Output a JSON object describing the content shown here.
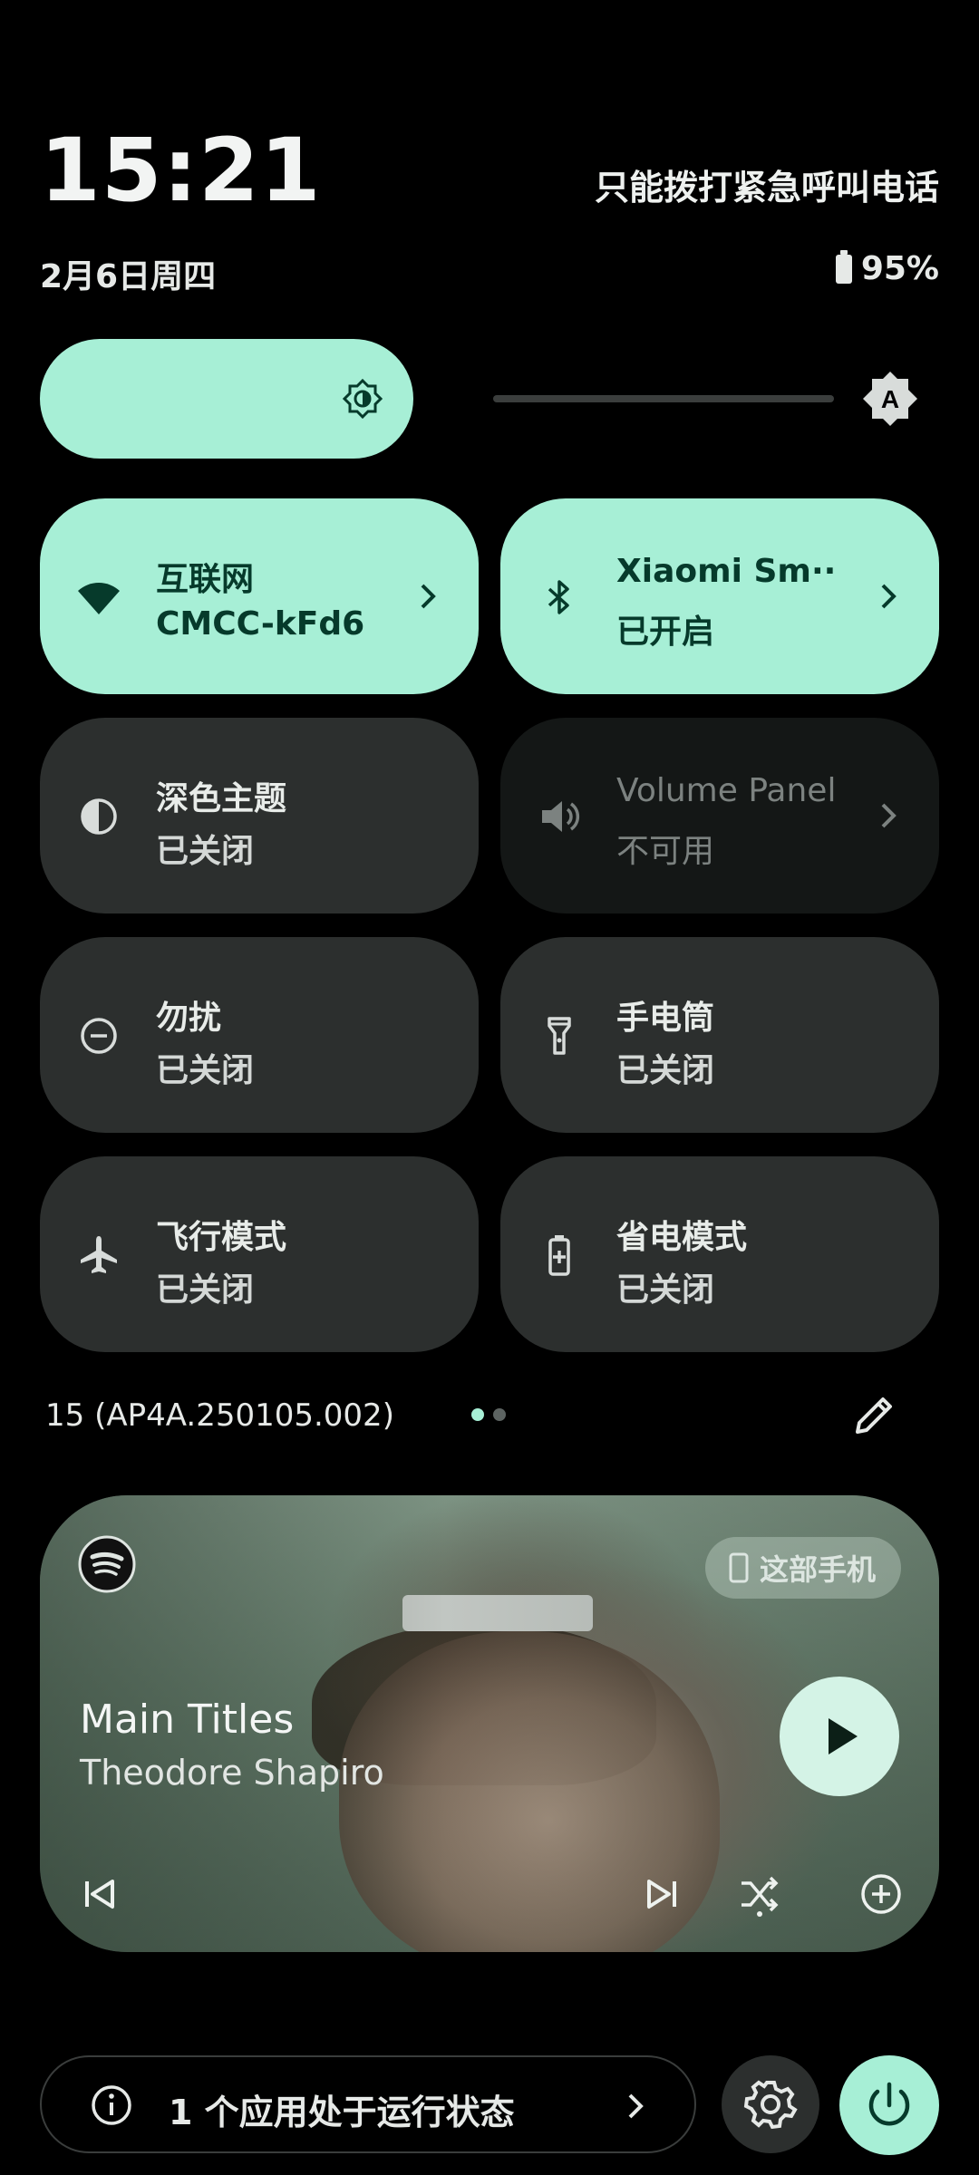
{
  "status": {
    "time": "15:21",
    "date": "2月6日周四",
    "network_notice": "只能拨打紧急呼叫电话",
    "battery": "95%"
  },
  "brightness": {
    "level": 0.4,
    "auto_icon": "auto-brightness-icon"
  },
  "tiles": [
    {
      "label": "互联网",
      "sub": "CMCC-kFd6",
      "icon": "wifi-icon",
      "state": "active"
    },
    {
      "label": "Xiaomi Sm··",
      "sub": "已开启",
      "icon": "bluetooth-icon",
      "state": "active"
    },
    {
      "label": "深色主题",
      "sub": "已关闭",
      "icon": "dark-theme-icon",
      "state": "off"
    },
    {
      "label": "Volume Panel",
      "sub": "不可用",
      "icon": "volume-icon",
      "state": "unavailable"
    },
    {
      "label": "勿扰",
      "sub": "已关闭",
      "icon": "do-not-disturb-icon",
      "state": "off"
    },
    {
      "label": "手电筒",
      "sub": "已关闭",
      "icon": "flashlight-icon",
      "state": "off"
    },
    {
      "label": "飞行模式",
      "sub": "已关闭",
      "icon": "airplane-icon",
      "state": "off"
    },
    {
      "label": "省电模式",
      "sub": "已关闭",
      "icon": "battery-saver-icon",
      "state": "off"
    }
  ],
  "build": "15 (AP4A.250105.002)",
  "pager": {
    "pages": 2,
    "current": 1
  },
  "media": {
    "app": "spotify-icon",
    "device": "这部手机",
    "title": "Main Titles",
    "artist": "Theodore Shapiro"
  },
  "footer": {
    "running_apps": "1 个应用处于运行状态"
  },
  "colors": {
    "accent": "#a7efd6",
    "tile_off": "#2c2f2e",
    "tile_unavailable": "#141716",
    "background": "#000000"
  }
}
